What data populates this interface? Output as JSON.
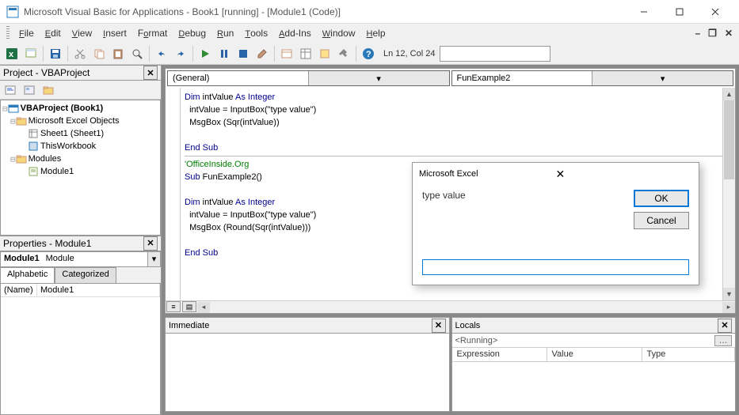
{
  "title": "Microsoft Visual Basic for Applications - Book1 [running] - [Module1 (Code)]",
  "menu": [
    "File",
    "Edit",
    "View",
    "Insert",
    "Format",
    "Debug",
    "Run",
    "Tools",
    "Add-Ins",
    "Window",
    "Help"
  ],
  "cursor_pos": "Ln 12, Col 24",
  "project_pane": {
    "title": "Project - VBAProject",
    "root": "VBAProject (Book1)",
    "folder1": "Microsoft Excel Objects",
    "sheet": "Sheet1 (Sheet1)",
    "wb": "ThisWorkbook",
    "folder2": "Modules",
    "mod": "Module1"
  },
  "props_pane": {
    "title": "Properties - Module1",
    "object_name": "Module1",
    "object_type": "Module",
    "tabs": [
      "Alphabetic",
      "Categorized"
    ],
    "rows": [
      {
        "name": "(Name)",
        "value": "Module1"
      }
    ]
  },
  "code": {
    "combo_left": "(General)",
    "combo_right": "FunExample2",
    "block1_l1_pre": "Dim",
    "block1_l1_mid": " intValue ",
    "block1_l1_key2": "As Integer",
    "block1_l2": "  intValue = InputBox(\"type value\")",
    "block1_l3": "  MsgBox (Sqr(intValue))",
    "endsub": "End Sub",
    "comment": "'OfficeInside.Org",
    "sub2_key": "Sub",
    "sub2_rest": " FunExample2()",
    "block2_l1_pre": "Dim",
    "block2_l1_mid": " intValue ",
    "block2_l1_key2": "As Integer",
    "block2_l2": "  intValue = InputBox(\"type value\")",
    "block2_l3": "  MsgBox (Round(Sqr(intValue)))"
  },
  "immediate_title": "Immediate",
  "locals": {
    "title": "Locals",
    "status": "<Running>",
    "cols": [
      "Expression",
      "Value",
      "Type"
    ]
  },
  "dialog": {
    "title": "Microsoft Excel",
    "message": "type value",
    "ok": "OK",
    "cancel": "Cancel",
    "input_value": ""
  }
}
